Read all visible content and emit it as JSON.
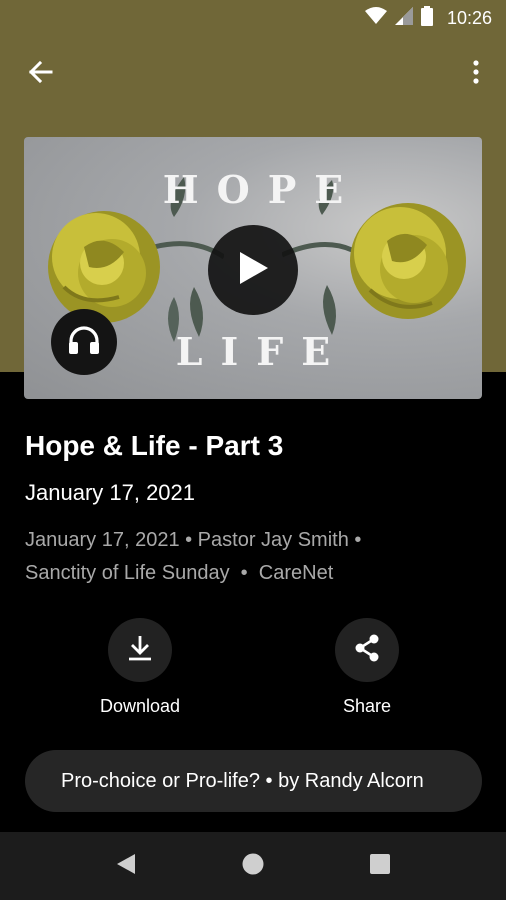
{
  "status_bar": {
    "time": "10:26",
    "icons": [
      "wifi-icon",
      "cell-signal-icon",
      "battery-icon"
    ]
  },
  "app_bar": {
    "back_icon": "arrow-left-icon",
    "menu_icon": "more-vertical-icon"
  },
  "artwork": {
    "word_top": "HOPE",
    "word_bottom": "LIFE",
    "play_icon": "play-icon",
    "audio_icon": "headphones-icon"
  },
  "sermon": {
    "title": "Hope & Life - Part 3",
    "date": "January 17, 2021",
    "meta_line1": "January 17, 2021 • Pastor Jay Smith •",
    "meta_line2": "Sanctity of Life Sunday  •  CareNet"
  },
  "actions": {
    "download_label": "Download",
    "share_label": "Share"
  },
  "series_chip": {
    "text": "Pro-choice or Pro-life?  •  by Randy Alcorn"
  },
  "colors": {
    "header": "#706738",
    "background": "#000000",
    "secondary_text": "#a9a9a9",
    "rose_yellow": "#c8bf3a",
    "chip": "#262626",
    "nav_bar": "#1c1c1c"
  }
}
